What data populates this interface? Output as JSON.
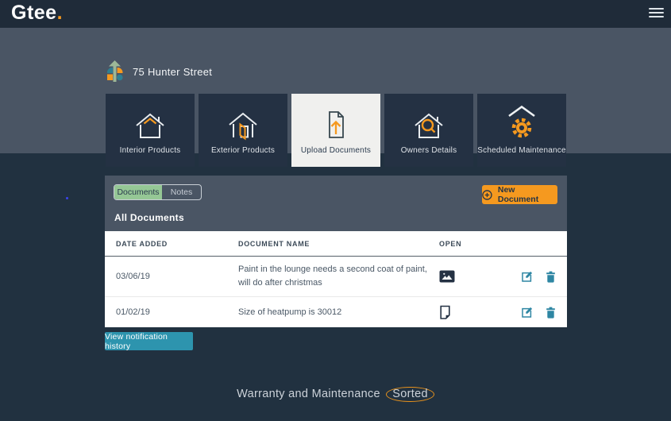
{
  "topbar": {
    "logo": "Gtee",
    "logo_period": "."
  },
  "header": {
    "property_name": "75 Hunter Street"
  },
  "nav_cards": [
    {
      "label": "Interior Products",
      "icon": "house-interior-icon",
      "selected": false
    },
    {
      "label": "Exterior Products",
      "icon": "house-door-icon",
      "selected": false
    },
    {
      "label": "Upload Documents",
      "icon": "document-upload-icon",
      "selected": true
    },
    {
      "label": "Owners Details",
      "icon": "house-search-icon",
      "selected": false
    },
    {
      "label": "Scheduled Maintenance",
      "icon": "gear-roof-icon",
      "selected": false
    }
  ],
  "panel": {
    "tabs": [
      {
        "label": "Documents",
        "active": true
      },
      {
        "label": "Notes",
        "active": false
      }
    ],
    "new_document_button": "New Document",
    "section_title": "All Documents",
    "table": {
      "headers": {
        "date": "DATE ADDED",
        "name": "DOCUMENT NAME",
        "open": "OPEN"
      },
      "rows": [
        {
          "date_added": "03/06/19",
          "document_name": "Paint in the lounge needs a second coat of paint, will do after christmas",
          "open_icon": "photo-icon"
        },
        {
          "date_added": "01/02/19",
          "document_name": "Size of heatpump is 30012",
          "open_icon": "note-icon"
        }
      ]
    }
  },
  "buttons": {
    "view_notification_history": "View notification history"
  },
  "footer": {
    "tagline_text": "Warranty and Maintenance",
    "tagline_highlight": "Sorted"
  },
  "colors": {
    "accent_orange": "#F5991F",
    "teal_button": "#2D94AE",
    "icon_teal": "#2E86A3",
    "tab_green": "#95C795",
    "topbar_navy": "#1F2B39",
    "main_navy": "#213140",
    "slate": "#4A5564",
    "card_navy": "#243143",
    "selected_card_bg": "#F0F0EE"
  }
}
